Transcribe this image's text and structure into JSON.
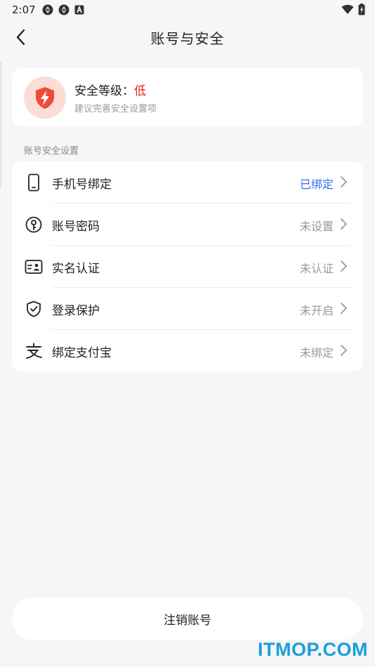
{
  "status_bar": {
    "time": "2:07",
    "icons": [
      "settings-notification-icon",
      "settings-notification-icon",
      "app-a-icon"
    ],
    "right_icons": [
      "wifi-icon",
      "battery-charging-icon"
    ]
  },
  "header": {
    "title": "账号与安全",
    "back_icon": "chevron-left-icon"
  },
  "security": {
    "level_prefix": "安全等级：",
    "level_value": "低",
    "hint": "建议完善安全设置项",
    "icon": "shield-lightning-icon",
    "accent_color": "#e2231a",
    "badge_bg": "#fbdcd7"
  },
  "section_label": "账号安全设置",
  "settings": [
    {
      "icon": "phone-icon",
      "label": "手机号绑定",
      "value": "已绑定",
      "value_color": "#2e6cf0"
    },
    {
      "icon": "key-icon",
      "label": "账号密码",
      "value": "未设置",
      "value_color": "#999999"
    },
    {
      "icon": "id-card-icon",
      "label": "实名认证",
      "value": "未认证",
      "value_color": "#999999"
    },
    {
      "icon": "shield-check-icon",
      "label": "登录保护",
      "value": "未开启",
      "value_color": "#999999"
    },
    {
      "icon": "alipay-icon",
      "label": "绑定支付宝",
      "value": "未绑定",
      "value_color": "#999999"
    }
  ],
  "footer": {
    "cancel_account_label": "注销账号"
  },
  "watermark": "ITMOP.COM"
}
